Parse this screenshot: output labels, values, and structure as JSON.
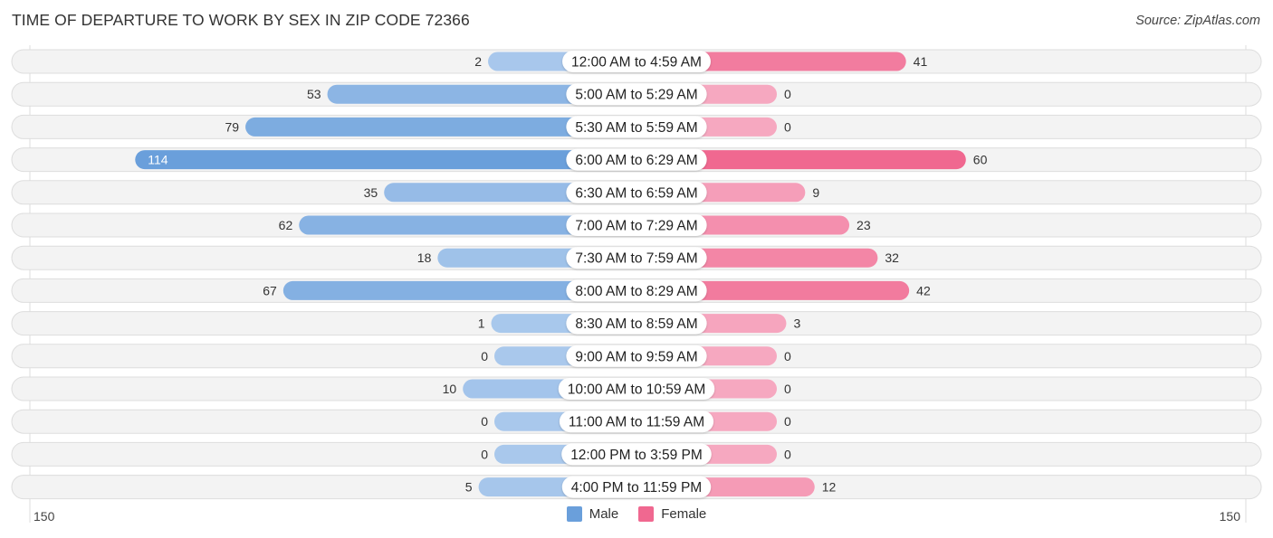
{
  "title": "TIME OF DEPARTURE TO WORK BY SEX IN ZIP CODE 72366",
  "source": "Source: ZipAtlas.com",
  "colors": {
    "male": "#6a9fdb",
    "male_light": "#a9c8ec",
    "female": "#f06890",
    "female_light": "#f6a8c0",
    "row_bg": "#f3f3f3",
    "row_border": "#dddddd"
  },
  "legend": [
    {
      "label": "Male",
      "color": "#6a9fdb"
    },
    {
      "label": "Female",
      "color": "#f06890"
    }
  ],
  "chart_data": {
    "type": "bar",
    "orientation": "horizontal-diverging",
    "title": "TIME OF DEPARTURE TO WORK BY SEX IN ZIP CODE 72366",
    "categories": [
      "12:00 AM to 4:59 AM",
      "5:00 AM to 5:29 AM",
      "5:30 AM to 5:59 AM",
      "6:00 AM to 6:29 AM",
      "6:30 AM to 6:59 AM",
      "7:00 AM to 7:29 AM",
      "7:30 AM to 7:59 AM",
      "8:00 AM to 8:29 AM",
      "8:30 AM to 8:59 AM",
      "9:00 AM to 9:59 AM",
      "10:00 AM to 10:59 AM",
      "11:00 AM to 11:59 AM",
      "12:00 PM to 3:59 PM",
      "4:00 PM to 11:59 PM"
    ],
    "series": [
      {
        "name": "Male",
        "values": [
          2,
          53,
          79,
          114,
          35,
          62,
          18,
          67,
          1,
          0,
          10,
          0,
          0,
          5
        ]
      },
      {
        "name": "Female",
        "values": [
          41,
          0,
          0,
          60,
          9,
          23,
          32,
          42,
          3,
          0,
          0,
          0,
          0,
          12
        ]
      }
    ],
    "axis": {
      "left_label": "150",
      "right_label": "150",
      "range": [
        0,
        150
      ]
    },
    "legend_position": "bottom-center",
    "grid": false
  }
}
